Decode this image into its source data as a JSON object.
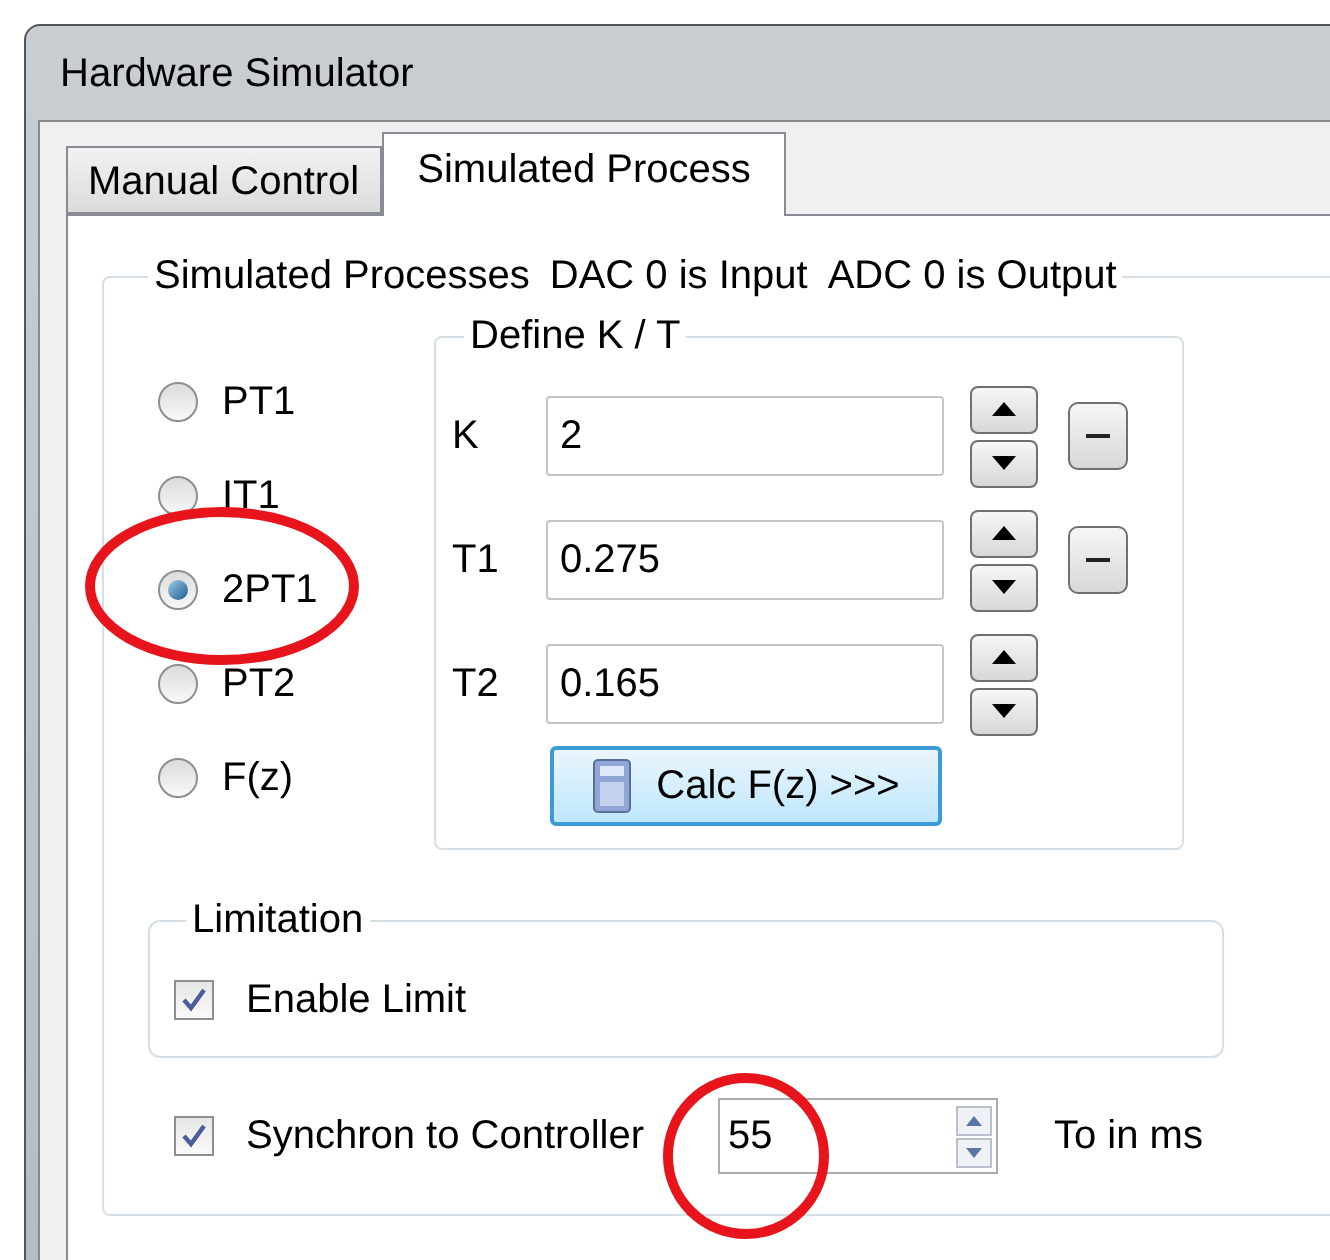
{
  "window": {
    "title": "Hardware Simulator"
  },
  "tabs": [
    {
      "label": "Manual Control",
      "selected": false
    },
    {
      "label": "Simulated Process",
      "selected": true
    }
  ],
  "process_group": {
    "title_parts": [
      "Simulated Processes",
      "DAC 0 is Input",
      "ADC 0 is Output"
    ],
    "options": [
      {
        "label": "PT1",
        "selected": false
      },
      {
        "label": "IT1",
        "selected": false
      },
      {
        "label": "2PT1",
        "selected": true
      },
      {
        "label": "PT2",
        "selected": false
      },
      {
        "label": "F(z)",
        "selected": false
      }
    ]
  },
  "parameters": {
    "title": "Define K / T",
    "rows": [
      {
        "label": "K",
        "value": "2",
        "has_minus_button": true
      },
      {
        "label": "T1",
        "value": "0.275",
        "has_minus_button": true
      },
      {
        "label": "T2",
        "value": "0.165",
        "has_minus_button": false
      }
    ],
    "calc_button": "Calc F(z) >>>"
  },
  "limitation": {
    "title": "Limitation",
    "enable_limit": {
      "label": "Enable Limit",
      "checked": true
    }
  },
  "synchron": {
    "label": "Synchron to Controller",
    "checked": true,
    "value": "55",
    "unit": "To in ms"
  }
}
